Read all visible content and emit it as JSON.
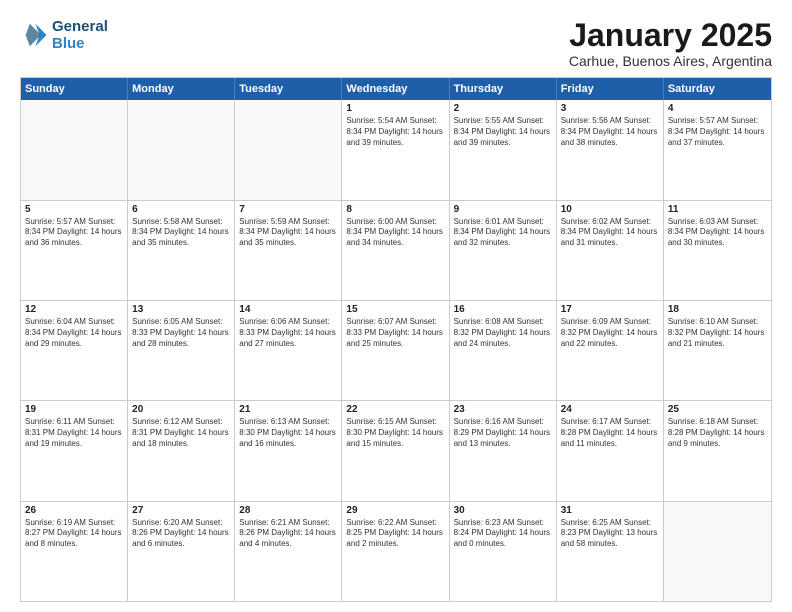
{
  "logo": {
    "line1": "General",
    "line2": "Blue"
  },
  "title": "January 2025",
  "subtitle": "Carhue, Buenos Aires, Argentina",
  "headers": [
    "Sunday",
    "Monday",
    "Tuesday",
    "Wednesday",
    "Thursday",
    "Friday",
    "Saturday"
  ],
  "weeks": [
    [
      {
        "day": "",
        "info": ""
      },
      {
        "day": "",
        "info": ""
      },
      {
        "day": "",
        "info": ""
      },
      {
        "day": "1",
        "info": "Sunrise: 5:54 AM\nSunset: 8:34 PM\nDaylight: 14 hours\nand 39 minutes."
      },
      {
        "day": "2",
        "info": "Sunrise: 5:55 AM\nSunset: 8:34 PM\nDaylight: 14 hours\nand 39 minutes."
      },
      {
        "day": "3",
        "info": "Sunrise: 5:56 AM\nSunset: 8:34 PM\nDaylight: 14 hours\nand 38 minutes."
      },
      {
        "day": "4",
        "info": "Sunrise: 5:57 AM\nSunset: 8:34 PM\nDaylight: 14 hours\nand 37 minutes."
      }
    ],
    [
      {
        "day": "5",
        "info": "Sunrise: 5:57 AM\nSunset: 8:34 PM\nDaylight: 14 hours\nand 36 minutes."
      },
      {
        "day": "6",
        "info": "Sunrise: 5:58 AM\nSunset: 8:34 PM\nDaylight: 14 hours\nand 35 minutes."
      },
      {
        "day": "7",
        "info": "Sunrise: 5:59 AM\nSunset: 8:34 PM\nDaylight: 14 hours\nand 35 minutes."
      },
      {
        "day": "8",
        "info": "Sunrise: 6:00 AM\nSunset: 8:34 PM\nDaylight: 14 hours\nand 34 minutes."
      },
      {
        "day": "9",
        "info": "Sunrise: 6:01 AM\nSunset: 8:34 PM\nDaylight: 14 hours\nand 32 minutes."
      },
      {
        "day": "10",
        "info": "Sunrise: 6:02 AM\nSunset: 8:34 PM\nDaylight: 14 hours\nand 31 minutes."
      },
      {
        "day": "11",
        "info": "Sunrise: 6:03 AM\nSunset: 8:34 PM\nDaylight: 14 hours\nand 30 minutes."
      }
    ],
    [
      {
        "day": "12",
        "info": "Sunrise: 6:04 AM\nSunset: 8:34 PM\nDaylight: 14 hours\nand 29 minutes."
      },
      {
        "day": "13",
        "info": "Sunrise: 6:05 AM\nSunset: 8:33 PM\nDaylight: 14 hours\nand 28 minutes."
      },
      {
        "day": "14",
        "info": "Sunrise: 6:06 AM\nSunset: 8:33 PM\nDaylight: 14 hours\nand 27 minutes."
      },
      {
        "day": "15",
        "info": "Sunrise: 6:07 AM\nSunset: 8:33 PM\nDaylight: 14 hours\nand 25 minutes."
      },
      {
        "day": "16",
        "info": "Sunrise: 6:08 AM\nSunset: 8:32 PM\nDaylight: 14 hours\nand 24 minutes."
      },
      {
        "day": "17",
        "info": "Sunrise: 6:09 AM\nSunset: 8:32 PM\nDaylight: 14 hours\nand 22 minutes."
      },
      {
        "day": "18",
        "info": "Sunrise: 6:10 AM\nSunset: 8:32 PM\nDaylight: 14 hours\nand 21 minutes."
      }
    ],
    [
      {
        "day": "19",
        "info": "Sunrise: 6:11 AM\nSunset: 8:31 PM\nDaylight: 14 hours\nand 19 minutes."
      },
      {
        "day": "20",
        "info": "Sunrise: 6:12 AM\nSunset: 8:31 PM\nDaylight: 14 hours\nand 18 minutes."
      },
      {
        "day": "21",
        "info": "Sunrise: 6:13 AM\nSunset: 8:30 PM\nDaylight: 14 hours\nand 16 minutes."
      },
      {
        "day": "22",
        "info": "Sunrise: 6:15 AM\nSunset: 8:30 PM\nDaylight: 14 hours\nand 15 minutes."
      },
      {
        "day": "23",
        "info": "Sunrise: 6:16 AM\nSunset: 8:29 PM\nDaylight: 14 hours\nand 13 minutes."
      },
      {
        "day": "24",
        "info": "Sunrise: 6:17 AM\nSunset: 8:28 PM\nDaylight: 14 hours\nand 11 minutes."
      },
      {
        "day": "25",
        "info": "Sunrise: 6:18 AM\nSunset: 8:28 PM\nDaylight: 14 hours\nand 9 minutes."
      }
    ],
    [
      {
        "day": "26",
        "info": "Sunrise: 6:19 AM\nSunset: 8:27 PM\nDaylight: 14 hours\nand 8 minutes."
      },
      {
        "day": "27",
        "info": "Sunrise: 6:20 AM\nSunset: 8:26 PM\nDaylight: 14 hours\nand 6 minutes."
      },
      {
        "day": "28",
        "info": "Sunrise: 6:21 AM\nSunset: 8:26 PM\nDaylight: 14 hours\nand 4 minutes."
      },
      {
        "day": "29",
        "info": "Sunrise: 6:22 AM\nSunset: 8:25 PM\nDaylight: 14 hours\nand 2 minutes."
      },
      {
        "day": "30",
        "info": "Sunrise: 6:23 AM\nSunset: 8:24 PM\nDaylight: 14 hours\nand 0 minutes."
      },
      {
        "day": "31",
        "info": "Sunrise: 6:25 AM\nSunset: 8:23 PM\nDaylight: 13 hours\nand 58 minutes."
      },
      {
        "day": "",
        "info": ""
      }
    ]
  ]
}
